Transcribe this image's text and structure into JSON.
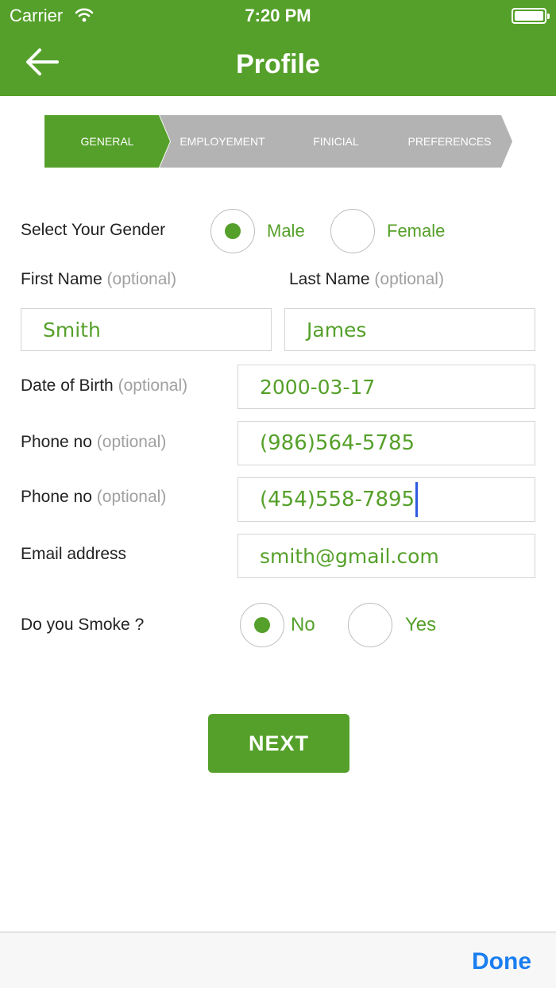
{
  "status_bar": {
    "carrier": "Carrier",
    "time": "7:20 PM"
  },
  "header": {
    "title": "Profile",
    "back_icon": "back-arrow-icon"
  },
  "stepper": {
    "steps": [
      {
        "label": "GENERAL",
        "active": true
      },
      {
        "label": "EMPLOYEMENT",
        "active": false
      },
      {
        "label": "FINICIAL",
        "active": false
      },
      {
        "label": "PREFERENCES",
        "active": false
      }
    ],
    "active_color": "#55a02a",
    "inactive_color": "#b3b3b3"
  },
  "form": {
    "gender": {
      "label": "Select Your Gender",
      "options": [
        "Male",
        "Female"
      ],
      "selected": "Male"
    },
    "first_name": {
      "label": "First Name",
      "optional": "(optional)",
      "value": "Smith"
    },
    "last_name": {
      "label": "Last Name",
      "optional": "(optional)",
      "value": "James"
    },
    "dob": {
      "label": "Date of Birth",
      "optional": "(optional)",
      "value": "2000-03-17"
    },
    "phone1": {
      "label": "Phone no",
      "optional": "(optional)",
      "value": "(986)564-5785"
    },
    "phone2": {
      "label": "Phone no",
      "optional": "(optional)",
      "value": "(454)558-7895"
    },
    "email": {
      "label": "Email address",
      "value": "smith@gmail.com"
    },
    "smoke": {
      "label": "Do you Smoke ?",
      "options": [
        "No",
        "Yes"
      ],
      "selected": "No"
    }
  },
  "next_button": "NEXT",
  "toolbar": {
    "done": "Done"
  },
  "colors": {
    "accent": "#55a02a",
    "link": "#1a7ef0"
  }
}
